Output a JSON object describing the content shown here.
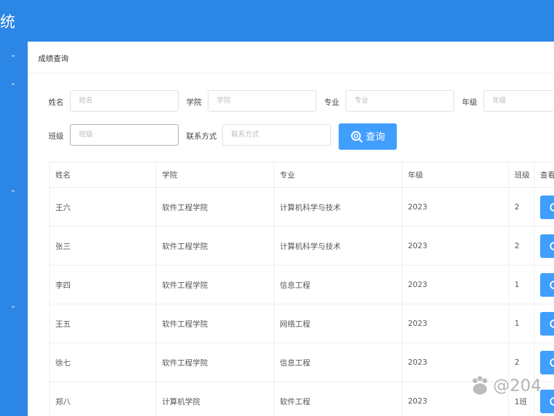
{
  "header": {
    "title": "统"
  },
  "breadcrumb": "成绩查询",
  "form": {
    "name_label": "姓名",
    "name_placeholder": "姓名",
    "college_label": "学院",
    "college_placeholder": "学院",
    "major_label": "专业",
    "major_placeholder": "专业",
    "grade_label": "年级",
    "grade_placeholder": "年级",
    "class_label": "班级",
    "class_placeholder": "班级",
    "contact_label": "联系方式",
    "contact_placeholder": "联系方式",
    "query_button": "查询"
  },
  "table": {
    "headers": [
      "姓名",
      "学院",
      "专业",
      "年级",
      "班级",
      "查看"
    ],
    "rows": [
      [
        "王六",
        "软件工程学院",
        "计算机科学与技术",
        "2023",
        "2"
      ],
      [
        "张三",
        "软件工程学院",
        "计算机科学与技术",
        "2023",
        "2"
      ],
      [
        "李四",
        "软件工程学院",
        "信息工程",
        "2023",
        "1"
      ],
      [
        "王五",
        "软件工程学院",
        "网络工程",
        "2023",
        "1"
      ],
      [
        "徐七",
        "软件工程学院",
        "信息工程",
        "2023",
        "2"
      ],
      [
        "郑八",
        "计算机学院",
        "软件工程",
        "2023",
        "1班"
      ]
    ]
  },
  "watermark": "@204",
  "colors": {
    "primary": "#2b86e6",
    "button": "#409eff"
  }
}
